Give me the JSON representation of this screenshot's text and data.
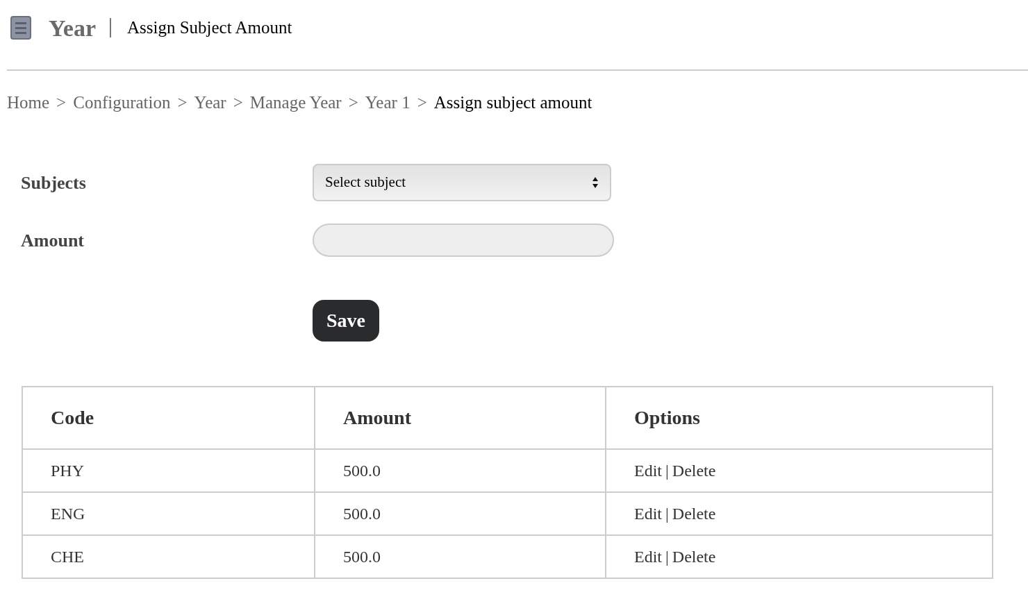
{
  "header": {
    "title": "Year",
    "subtitle": "Assign Subject Amount"
  },
  "breadcrumb": [
    {
      "kind": "link",
      "text": "Home"
    },
    {
      "kind": "separator",
      "text": ">"
    },
    {
      "kind": "link",
      "text": "Configuration"
    },
    {
      "kind": "separator",
      "text": ">"
    },
    {
      "kind": "link",
      "text": "Year"
    },
    {
      "kind": "separator",
      "text": ">"
    },
    {
      "kind": "link",
      "text": "Manage Year"
    },
    {
      "kind": "separator",
      "text": ">"
    },
    {
      "kind": "link",
      "text": "Year 1"
    },
    {
      "kind": "separator",
      "text": ">"
    },
    {
      "kind": "current",
      "text": "Assign subject amount"
    }
  ],
  "form": {
    "subjects_label": "Subjects",
    "subject_select": {
      "value": "Select subject"
    },
    "amount_label": "Amount",
    "save_button": "Save"
  },
  "table": {
    "columns": [
      "Code",
      "Amount",
      "Options"
    ],
    "rows": [
      {
        "code": "PHY",
        "amount": "500.0",
        "options": {
          "edit": "Edit",
          "divider": "|",
          "delete": "Delete"
        }
      },
      {
        "code": "ENG",
        "amount": "500.0",
        "options": {
          "edit": "Edit",
          "divider": "|",
          "delete": "Delete"
        }
      },
      {
        "code": "CHE",
        "amount": "500.0",
        "options": {
          "edit": "Edit",
          "divider": "|",
          "delete": "Delete"
        }
      }
    ]
  }
}
